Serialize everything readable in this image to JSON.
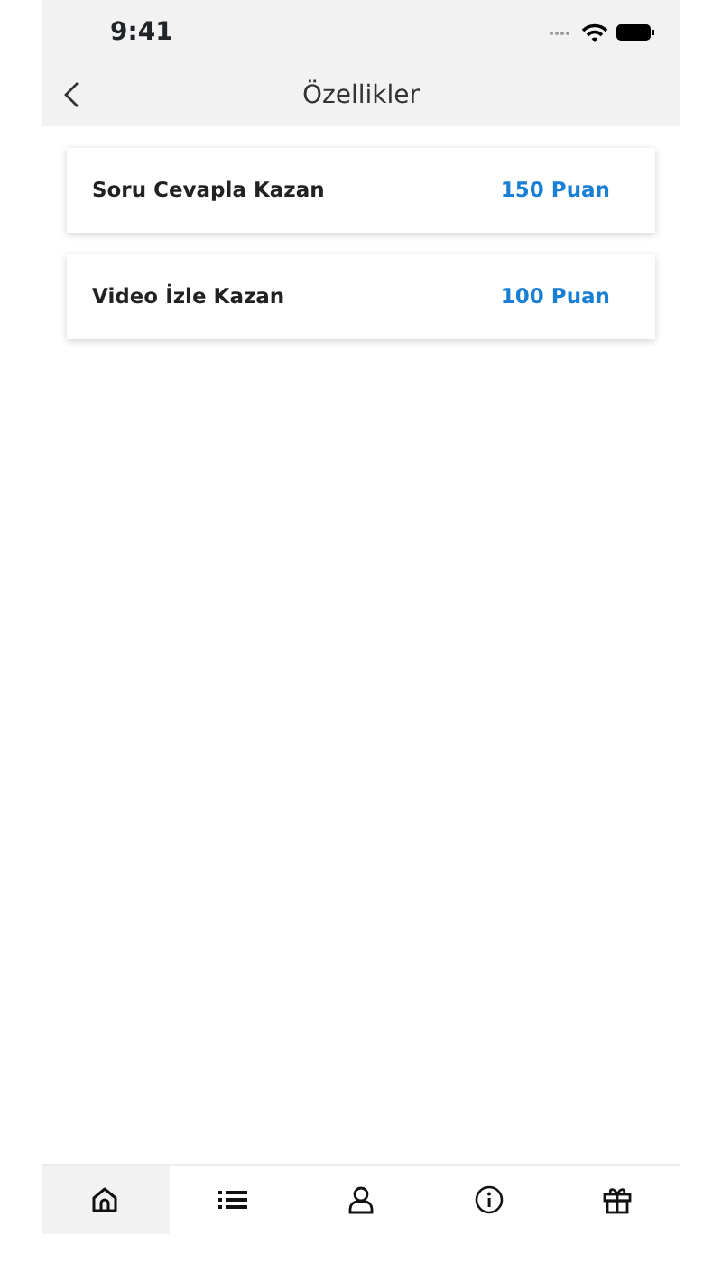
{
  "status_bar": {
    "time": "9:41"
  },
  "nav": {
    "title": "Özellikler"
  },
  "items": [
    {
      "title": "Soru Cevapla Kazan",
      "points": "150 Puan"
    },
    {
      "title": "Video İzle Kazan",
      "points": "100 Puan"
    }
  ],
  "tabs": [
    {
      "kind": "home",
      "selected": true
    },
    {
      "kind": "list",
      "selected": false
    },
    {
      "kind": "user",
      "selected": false
    },
    {
      "kind": "info",
      "selected": false
    },
    {
      "kind": "gift",
      "selected": false
    }
  ]
}
